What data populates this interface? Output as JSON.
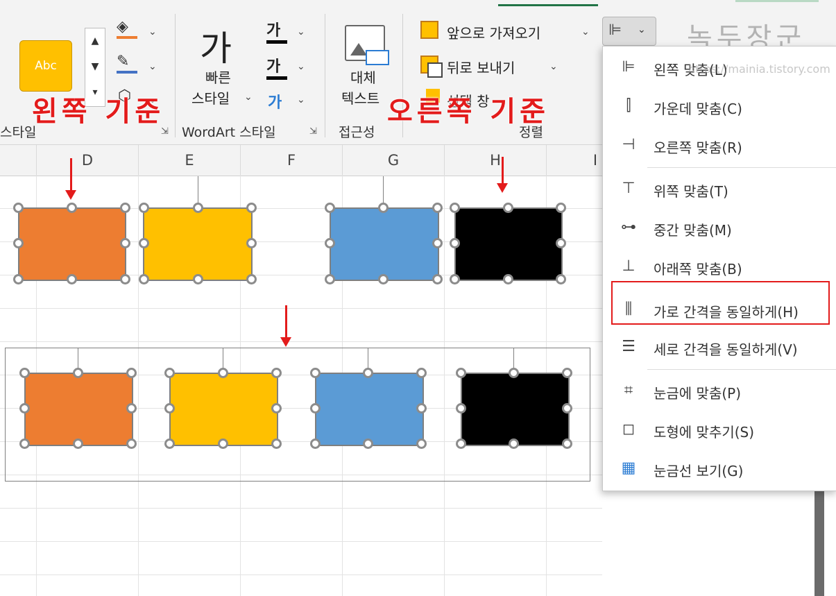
{
  "ribbon": {
    "shape_style_group": {
      "abc_label": "Abc",
      "label": "스타일"
    },
    "wordart_group": {
      "quick_style_label_1": "빠른",
      "quick_style_label_2": "스타일",
      "char_1": "가",
      "char_2": "가",
      "char_3": "가",
      "label": "WordArt 스타일"
    },
    "accessibility_group": {
      "alt_text_1": "대체",
      "alt_text_2": "텍스트",
      "label": "접근성"
    },
    "arrange_group": {
      "bring_forward": "앞으로 가져오기",
      "send_backward": "뒤로 보내기",
      "selection_pane": "선택 창",
      "label": "정렬"
    }
  },
  "annotations": {
    "left_base": "왼쪽 기준",
    "right_base": "오른쪽 기준"
  },
  "watermark": {
    "logo_text": "녹두장군",
    "url": "https://mainia.tistory.com"
  },
  "sheet": {
    "columns": [
      "D",
      "E",
      "F",
      "G",
      "H",
      "I"
    ]
  },
  "shapes": {
    "colors": {
      "orange": "#ed7d31",
      "yellow": "#ffc000",
      "blue": "#5b9bd5",
      "black": "#000000"
    }
  },
  "align_menu": {
    "items": [
      {
        "icon": "align-left-icon",
        "label": "왼쪽 맞춤(L)"
      },
      {
        "icon": "align-center-icon",
        "label": "가운데 맞춤(C)"
      },
      {
        "icon": "align-right-icon",
        "label": "오른쪽 맞춤(R)"
      },
      {
        "icon": "align-top-icon",
        "label": "위쪽 맞춤(T)"
      },
      {
        "icon": "align-middle-icon",
        "label": "중간 맞춤(M)"
      },
      {
        "icon": "align-bottom-icon",
        "label": "아래쪽 맞춤(B)"
      },
      {
        "icon": "distribute-horizontally-icon",
        "label": "가로 간격을 동일하게(H)"
      },
      {
        "icon": "distribute-vertically-icon",
        "label": "세로 간격을 동일하게(V)"
      },
      {
        "icon": "snap-to-grid-icon",
        "label": "눈금에 맞춤(P)"
      },
      {
        "icon": "snap-to-shape-icon",
        "label": "도형에 맞추기(S)"
      },
      {
        "icon": "view-gridlines-icon",
        "label": "눈금선 보기(G)"
      }
    ],
    "highlighted": "가로 간격을 동일하게(H)"
  }
}
